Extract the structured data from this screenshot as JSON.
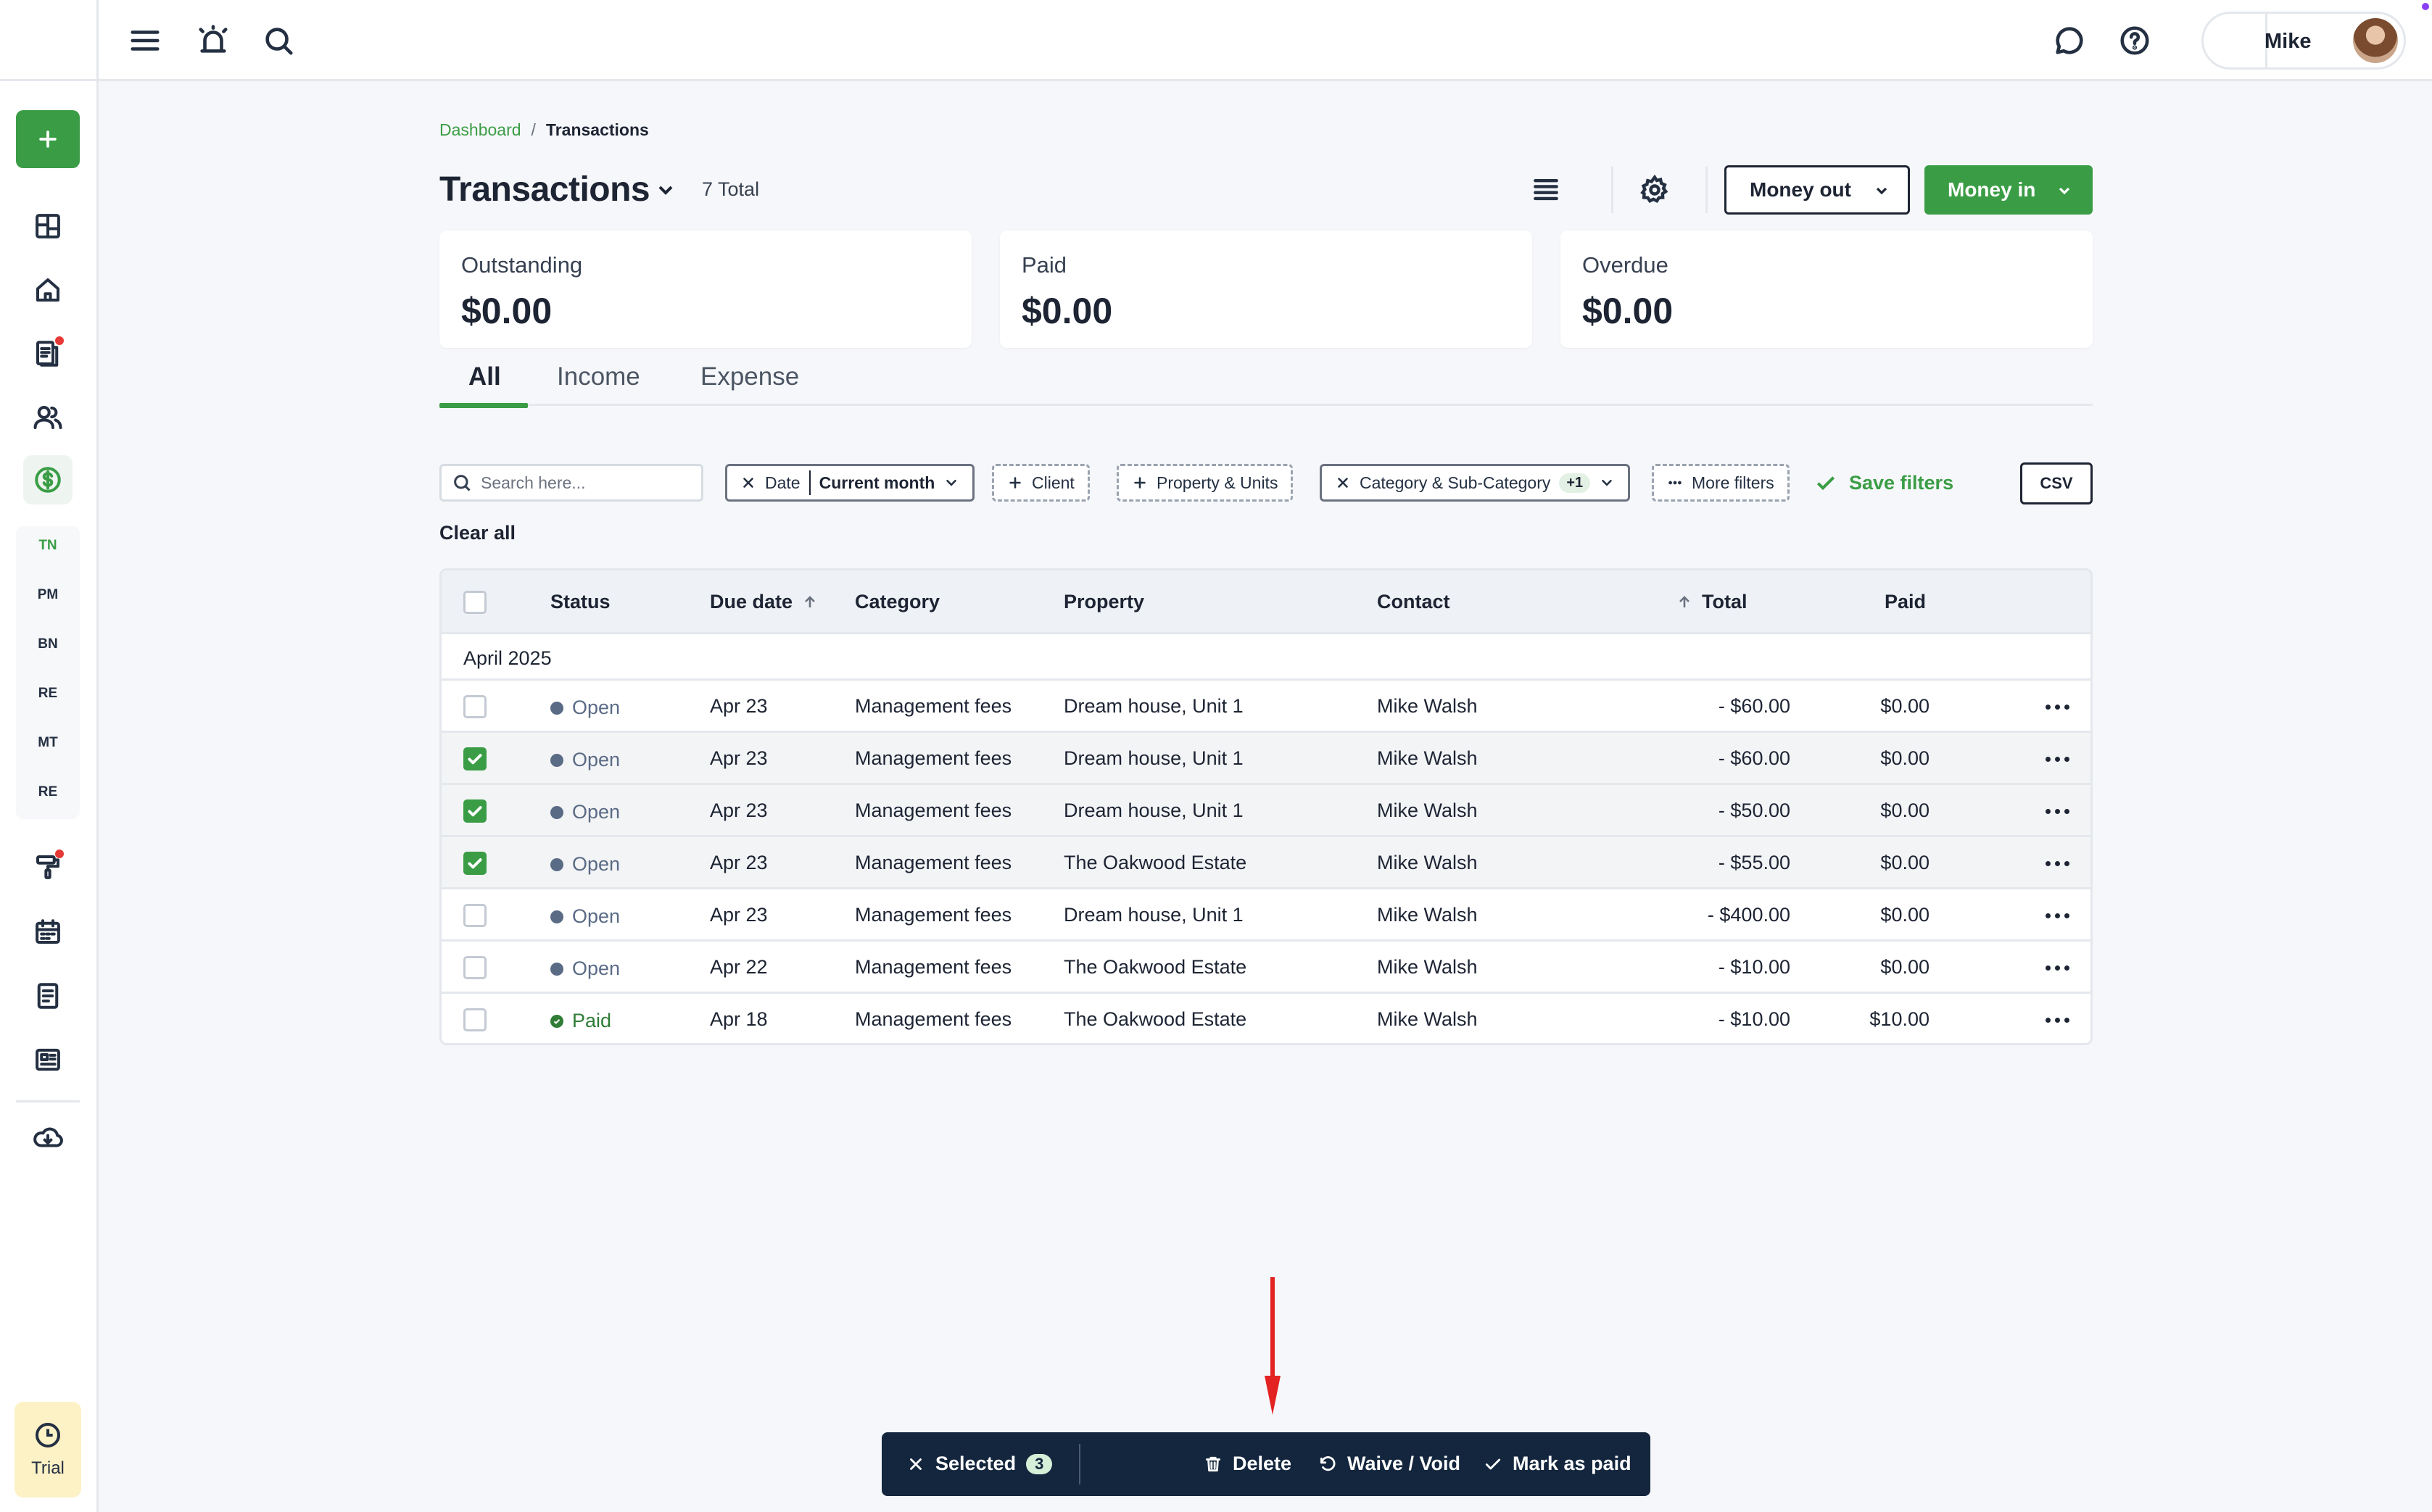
{
  "sidebar": {
    "abbreviations": [
      {
        "label": "TN",
        "active": true
      },
      {
        "label": "PM",
        "active": false
      },
      {
        "label": "BN",
        "active": false
      },
      {
        "label": "RE",
        "active": false
      },
      {
        "label": "MT",
        "active": false
      },
      {
        "label": "RE",
        "active": false
      }
    ],
    "trial_label": "Trial"
  },
  "topbar": {
    "user_name": "Mike"
  },
  "breadcrumb": {
    "parent": "Dashboard",
    "separator": "/",
    "current": "Transactions"
  },
  "header": {
    "title": "Transactions",
    "total_count": "7 Total",
    "money_out_label": "Money out",
    "money_in_label": "Money in"
  },
  "summary": {
    "outstanding_label": "Outstanding",
    "outstanding_value": "$0.00",
    "paid_label": "Paid",
    "paid_value": "$0.00",
    "overdue_label": "Overdue",
    "overdue_value": "$0.00"
  },
  "tabs": {
    "all": "All",
    "income": "Income",
    "expense": "Expense",
    "active": "All"
  },
  "filters": {
    "search_placeholder": "Search here...",
    "date_label": "Date",
    "date_value": "Current month",
    "client_label": "Client",
    "property_label": "Property & Units",
    "category_label": "Category & Sub-Category",
    "category_badge": "+1",
    "more_filters_label": "More filters",
    "save_filters_label": "Save filters",
    "csv_label": "CSV",
    "clear_all_label": "Clear all"
  },
  "table": {
    "headers": {
      "status": "Status",
      "due_date": "Due date",
      "category": "Category",
      "property": "Property",
      "contact": "Contact",
      "total": "Total",
      "paid": "Paid"
    },
    "group_label": "April 2025",
    "rows": [
      {
        "checked": false,
        "status": "Open",
        "due": "Apr 23",
        "category": "Management fees",
        "property": "Dream house, Unit 1",
        "contact": "Mike Walsh",
        "total": "- $60.00",
        "paid": "$0.00"
      },
      {
        "checked": true,
        "status": "Open",
        "due": "Apr 23",
        "category": "Management fees",
        "property": "Dream house, Unit 1",
        "contact": "Mike Walsh",
        "total": "- $60.00",
        "paid": "$0.00"
      },
      {
        "checked": true,
        "status": "Open",
        "due": "Apr 23",
        "category": "Management fees",
        "property": "Dream house, Unit 1",
        "contact": "Mike Walsh",
        "total": "- $50.00",
        "paid": "$0.00"
      },
      {
        "checked": true,
        "status": "Open",
        "due": "Apr 23",
        "category": "Management fees",
        "property": "The Oakwood Estate",
        "contact": "Mike Walsh",
        "total": "- $55.00",
        "paid": "$0.00"
      },
      {
        "checked": false,
        "status": "Open",
        "due": "Apr 23",
        "category": "Management fees",
        "property": "Dream house, Unit 1",
        "contact": "Mike Walsh",
        "total": "- $400.00",
        "paid": "$0.00"
      },
      {
        "checked": false,
        "status": "Open",
        "due": "Apr 22",
        "category": "Management fees",
        "property": "The Oakwood Estate",
        "contact": "Mike Walsh",
        "total": "- $10.00",
        "paid": "$0.00"
      },
      {
        "checked": false,
        "status": "Paid",
        "due": "Apr 18",
        "category": "Management fees",
        "property": "The Oakwood Estate",
        "contact": "Mike Walsh",
        "total": "- $10.00",
        "paid": "$10.00"
      }
    ]
  },
  "action_bar": {
    "selected_label": "Selected",
    "selected_count": "3",
    "delete_label": "Delete",
    "waive_label": "Waive / Void",
    "mark_paid_label": "Mark as paid"
  },
  "colors": {
    "brand_green": "#3a9d45",
    "action_bar_bg": "#13263d",
    "open_status": "#5a6b86",
    "paid_status": "#2f7d36",
    "annotation_arrow": "#e32222"
  }
}
